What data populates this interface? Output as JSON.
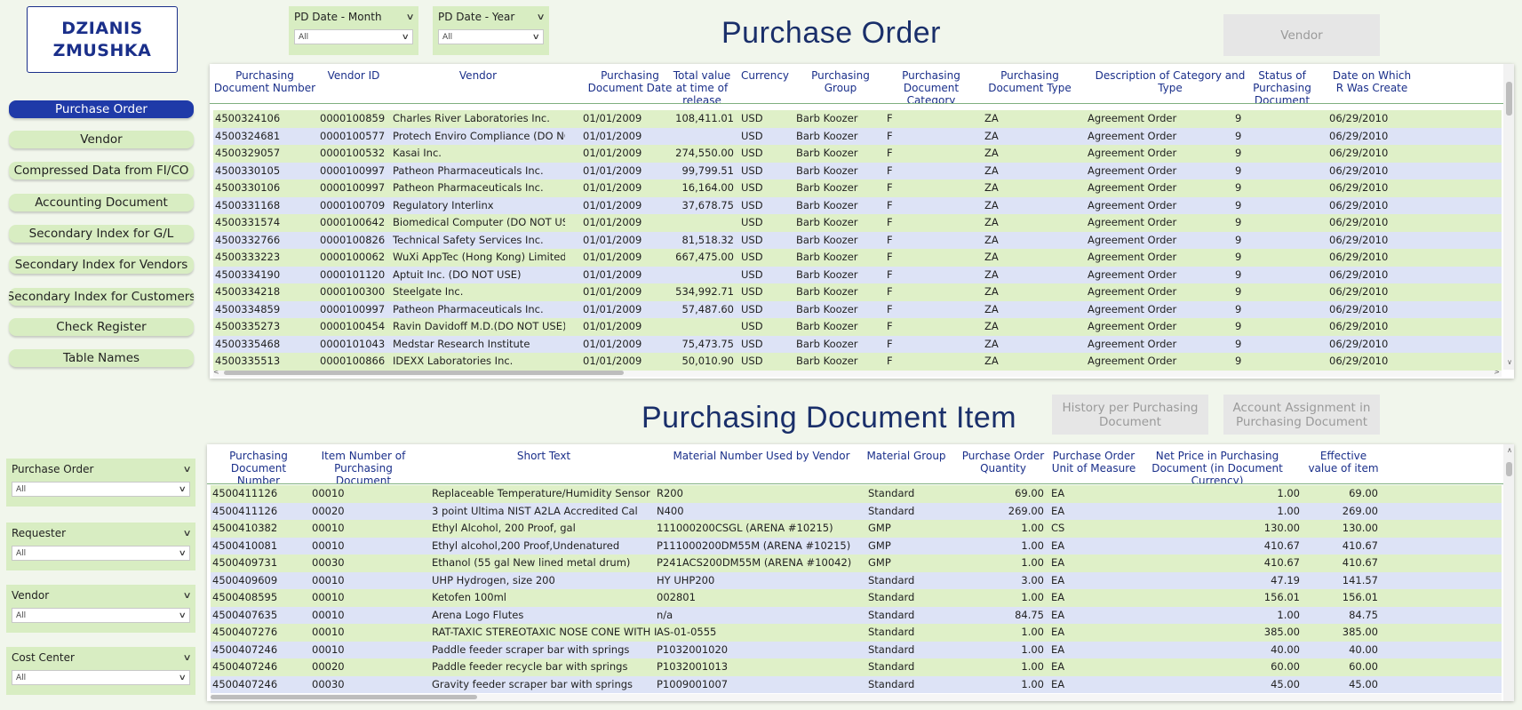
{
  "logo": {
    "line1": "DZIANIS",
    "line2": "ZMUSHKA"
  },
  "nav": [
    {
      "label": "Purchase Order",
      "active": true
    },
    {
      "label": "Vendor"
    },
    {
      "label": "Compressed Data from FI/CO"
    },
    {
      "label": "Accounting Document"
    },
    {
      "label": "Secondary Index for G/L"
    },
    {
      "label": "Secondary Index for Vendors"
    },
    {
      "label": "Secondary Index for Customers"
    },
    {
      "label": "Check Register"
    },
    {
      "label": "Table Names"
    }
  ],
  "top_filters": [
    {
      "label": "PD Date - Month",
      "value": "All"
    },
    {
      "label": "PD Date - Year",
      "value": "All"
    }
  ],
  "side_filters": [
    {
      "label": "Purchase Order",
      "value": "All"
    },
    {
      "label": "Requester",
      "value": "All"
    },
    {
      "label": "Vendor",
      "value": "All"
    },
    {
      "label": "Cost Center",
      "value": "All"
    }
  ],
  "titles": {
    "po": "Purchase Order",
    "pdi": "Purchasing Document Item"
  },
  "buttons": {
    "vendor": "Vendor",
    "history": "History per Purchasing Document",
    "account": "Account Assignment in Purchasing Document"
  },
  "po_table": {
    "columns": [
      "Purchasing Document Number",
      "Vendor ID",
      "Vendor",
      "Purchasing Document Date",
      "Total value at time of release",
      "Currency",
      "Purchasing Group",
      "Purchasing Document Category",
      "Purchasing Document Type",
      "Description of Category and Type",
      "Status of Purchasing Document",
      "Date on Which R Was Create"
    ],
    "rows": [
      [
        "4500324106",
        "0000100859",
        "Charles River Laboratories Inc.",
        "01/01/2009",
        "108,411.01",
        "USD",
        "Barb Koozer",
        "F",
        "ZA",
        "Agreement Order",
        "9",
        "06/29/2010"
      ],
      [
        "4500324681",
        "0000100577",
        "Protech Enviro Compliance (DO NOT U",
        "01/01/2009",
        "",
        "USD",
        "Barb Koozer",
        "F",
        "ZA",
        "Agreement Order",
        "9",
        "06/29/2010"
      ],
      [
        "4500329057",
        "0000100532",
        "Kasai Inc.",
        "01/01/2009",
        "274,550.00",
        "USD",
        "Barb Koozer",
        "F",
        "ZA",
        "Agreement Order",
        "9",
        "06/29/2010"
      ],
      [
        "4500330105",
        "0000100997",
        "Patheon Pharmaceuticals Inc.",
        "01/01/2009",
        "99,799.51",
        "USD",
        "Barb Koozer",
        "F",
        "ZA",
        "Agreement Order",
        "9",
        "06/29/2010"
      ],
      [
        "4500330106",
        "0000100997",
        "Patheon Pharmaceuticals Inc.",
        "01/01/2009",
        "16,164.00",
        "USD",
        "Barb Koozer",
        "F",
        "ZA",
        "Agreement Order",
        "9",
        "06/29/2010"
      ],
      [
        "4500331168",
        "0000100709",
        "Regulatory Interlinx",
        "01/01/2009",
        "37,678.75",
        "USD",
        "Barb Koozer",
        "F",
        "ZA",
        "Agreement Order",
        "9",
        "06/29/2010"
      ],
      [
        "4500331574",
        "0000100642",
        "Biomedical Computer (DO NOT USE)",
        "01/01/2009",
        "",
        "USD",
        "Barb Koozer",
        "F",
        "ZA",
        "Agreement Order",
        "9",
        "06/29/2010"
      ],
      [
        "4500332766",
        "0000100826",
        "Technical Safety Services Inc.",
        "01/01/2009",
        "81,518.32",
        "USD",
        "Barb Koozer",
        "F",
        "ZA",
        "Agreement Order",
        "9",
        "06/29/2010"
      ],
      [
        "4500333223",
        "0000100062",
        "WuXi AppTec (Hong Kong) Limited",
        "01/01/2009",
        "667,475.00",
        "USD",
        "Barb Koozer",
        "F",
        "ZA",
        "Agreement Order",
        "9",
        "06/29/2010"
      ],
      [
        "4500334190",
        "0000101120",
        "Aptuit Inc. (DO NOT USE)",
        "01/01/2009",
        "",
        "USD",
        "Barb Koozer",
        "F",
        "ZA",
        "Agreement Order",
        "9",
        "06/29/2010"
      ],
      [
        "4500334218",
        "0000100300",
        "Steelgate Inc.",
        "01/01/2009",
        "534,992.71",
        "USD",
        "Barb Koozer",
        "F",
        "ZA",
        "Agreement Order",
        "9",
        "06/29/2010"
      ],
      [
        "4500334859",
        "0000100997",
        "Patheon Pharmaceuticals Inc.",
        "01/01/2009",
        "57,487.60",
        "USD",
        "Barb Koozer",
        "F",
        "ZA",
        "Agreement Order",
        "9",
        "06/29/2010"
      ],
      [
        "4500335273",
        "0000100454",
        "Ravin Davidoff M.D.(DO NOT USE)",
        "01/01/2009",
        "",
        "USD",
        "Barb Koozer",
        "F",
        "ZA",
        "Agreement Order",
        "9",
        "06/29/2010"
      ],
      [
        "4500335468",
        "0000101043",
        "Medstar Research Institute",
        "01/01/2009",
        "75,473.75",
        "USD",
        "Barb Koozer",
        "F",
        "ZA",
        "Agreement Order",
        "9",
        "06/29/2010"
      ],
      [
        "4500335513",
        "0000100866",
        "IDEXX Laboratories Inc.",
        "01/01/2009",
        "50,010.90",
        "USD",
        "Barb Koozer",
        "F",
        "ZA",
        "Agreement Order",
        "9",
        "06/29/2010"
      ]
    ]
  },
  "pdi_table": {
    "columns": [
      "Purchasing Document Number",
      "Item Number of Purchasing Document",
      "Short Text",
      "Material Number Used by Vendor",
      "Material Group",
      "Purchase Order Quantity",
      "Purchase Order Unit of Measure",
      "Net Price in Purchasing Document (in Document Currency)",
      "Effective value of item"
    ],
    "rows": [
      [
        "4500411126",
        "00010",
        "Replaceable Temperature/Humidity Sensor",
        "R200",
        "Standard",
        "69.00",
        "EA",
        "1.00",
        "69.00"
      ],
      [
        "4500411126",
        "00020",
        "3 point Ultima NIST A2LA Accredited Cal",
        "N400",
        "Standard",
        "269.00",
        "EA",
        "1.00",
        "269.00"
      ],
      [
        "4500410382",
        "00010",
        "Ethyl Alcohol, 200 Proof, gal",
        "111000200CSGL (ARENA #10215)",
        "GMP",
        "1.00",
        "CS",
        "130.00",
        "130.00"
      ],
      [
        "4500410081",
        "00010",
        "Ethyl alcohol,200 Proof,Undenatured",
        "P111000200DM55M (ARENA #10215)",
        "GMP",
        "1.00",
        "EA",
        "410.67",
        "410.67"
      ],
      [
        "4500409731",
        "00030",
        "Ethanol (55 gal New lined metal drum)",
        "P241ACS200DM55M (ARENA #10042)",
        "GMP",
        "1.00",
        "EA",
        "410.67",
        "410.67"
      ],
      [
        "4500409609",
        "00010",
        "UHP Hydrogen, size 200",
        "HY UHP200",
        "Standard",
        "3.00",
        "EA",
        "47.19",
        "141.57"
      ],
      [
        "4500408595",
        "00010",
        "Ketofen 100ml",
        "002801",
        "Standard",
        "1.00",
        "EA",
        "156.01",
        "156.01"
      ],
      [
        "4500407635",
        "00010",
        "Arena Logo Flutes",
        "n/a",
        "Standard",
        "84.75",
        "EA",
        "1.00",
        "84.75"
      ],
      [
        "4500407276",
        "00010",
        "RAT-TAXIC STEREOTAXIC NOSE CONE WITH INT",
        "AS-01-0555",
        "Standard",
        "1.00",
        "EA",
        "385.00",
        "385.00"
      ],
      [
        "4500407246",
        "00010",
        "Paddle feeder scraper bar with springs",
        "P1032001020",
        "Standard",
        "1.00",
        "EA",
        "40.00",
        "40.00"
      ],
      [
        "4500407246",
        "00020",
        "Paddle feeder recycle bar with springs",
        "P1032001013",
        "Standard",
        "1.00",
        "EA",
        "60.00",
        "60.00"
      ],
      [
        "4500407246",
        "00030",
        "Gravity feeder scraper bar with springs",
        "P1009001007",
        "Standard",
        "1.00",
        "EA",
        "45.00",
        "45.00"
      ]
    ]
  }
}
